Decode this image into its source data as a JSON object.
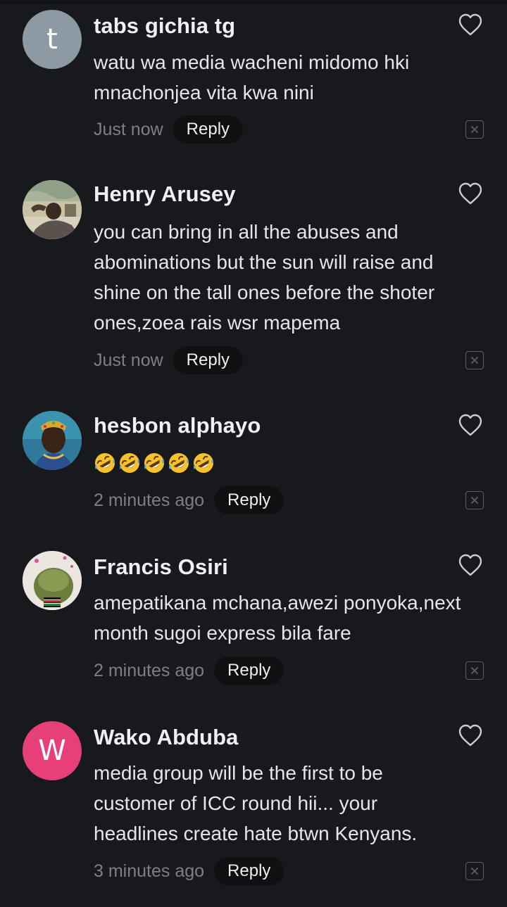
{
  "comments": [
    {
      "name": "tabs gichia tg",
      "avatar_initial": "t",
      "avatar_color": "#8e9aa3",
      "text": "watu wa media wacheni midomo hki\nmnachonjea vita kwa nini",
      "time": "Just now",
      "reply_label": "Reply"
    },
    {
      "name": "Henry Arusey",
      "avatar_type": "photo",
      "text": "you can bring in all the abuses and\nabominations but the sun will raise and\nshine on the tall ones before the shoter\nones,zoea rais wsr mapema",
      "time": "Just now",
      "reply_label": "Reply"
    },
    {
      "name": "hesbon alphayo",
      "avatar_type": "photo",
      "emoji_count": 5,
      "emoji_name": "rolling-on-the-floor-laughing",
      "time": "2 minutes ago",
      "reply_label": "Reply"
    },
    {
      "name": "Francis Osiri",
      "avatar_type": "photo",
      "text": "amepatikana mchana,awezi ponyoka,next\nmonth sugoi express bila fare",
      "time": "2 minutes ago",
      "reply_label": "Reply"
    },
    {
      "name": "Wako Abduba",
      "avatar_initial": "W",
      "avatar_color": "#e73f7a",
      "text": "media group will be the first to be\ncustomer of ICC round hii... your\nheadlines create hate btwn Kenyans.",
      "time": "3 minutes ago",
      "reply_label": "Reply"
    }
  ],
  "icons": {
    "like": "heart-outline-icon",
    "remove": "close-icon"
  },
  "colors": {
    "background": "#17191c",
    "reply_pill": "#0e1012",
    "timestamp": "#7c8086"
  }
}
